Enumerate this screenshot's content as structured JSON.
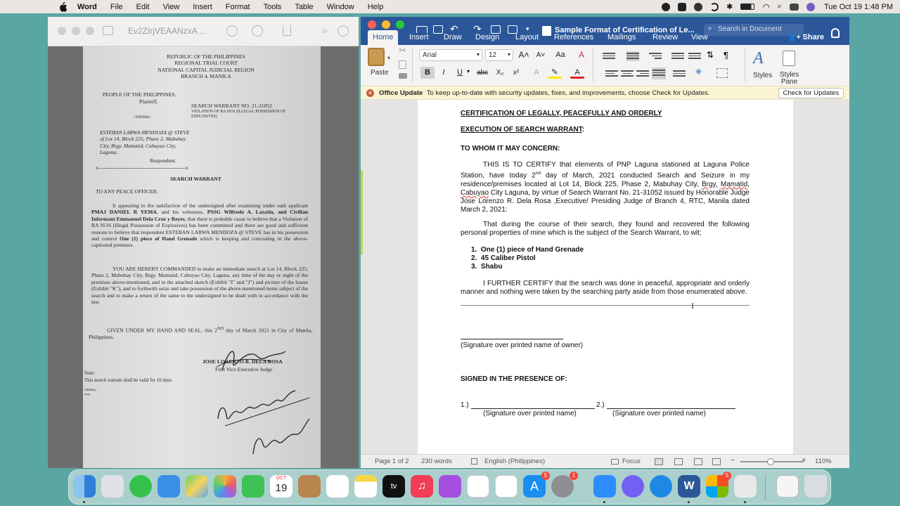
{
  "menubar": {
    "app": "Word",
    "items": [
      "File",
      "Edit",
      "View",
      "Insert",
      "Format",
      "Tools",
      "Table",
      "Window",
      "Help"
    ],
    "clock": "Tue Oct 19  1:48 PM"
  },
  "preview": {
    "title": "Ev2ZIrjVEAANzxA....",
    "doc": {
      "header": [
        "REPUBLIC OF THE PHILIPPINES",
        "REGIONAL TRIAL COURT",
        "NATIONAL CAPITAL JUDICIAL REGION",
        "BRANCH 4, MANILA"
      ],
      "plaintiff": "PEOPLE OF THE PHILIPPINES,",
      "plaintiff_role": "Plaintiff,",
      "warrant_no": "SEARCH WARRANT NO. 21-31052",
      "violation": "VIOLATION OF RA 9516 (ILLEGAL POSSESSION OF EXPLOSIVES)",
      "versus": "-versus-",
      "respondent_name": "ESTEBAN LARWA MENDOZA @ STEVE of Lot 14, Block 225, Phase 2, Mabuhay City, Brgy. Mamatid, Cabuyao City, Laguna,",
      "respondent_role": "Respondent.",
      "divider": "x-------------------------------------------------x",
      "heading": "SEARCH WARRANT",
      "salutation": "TO ANY PEACE OFFICER:",
      "p1_a": "It appearing to the satisfaction of the undersigned after examining under oath applicant ",
      "p1_b": "PMAJ DANIEL R YEMA",
      "p1_c": ", and his witnesses, ",
      "p1_d": "PSSG Wilfredo A. Lazatin, and Civilian Informant Emmanuel Dela Cruz y Reyes",
      "p1_e": ", that there is probable cause to believe that a Violation of RA 9516 (Illegal Possession of Explosives) has been committed and there are good and sufficient reasons to believe that respondent ESTEBAN LARWA MENDOZA @ STEVE has in his possession and control ",
      "p1_f": "One (1) piece of Hand Grenade",
      "p1_g": " which is keeping and concealing in the above-captioned premises.",
      "p2": "YOU ARE HEREBY COMMANDED to make an immediate search at Lot 14, Block 225, Phase 2, Mabuhay City, Brgy. Mamatid, Cabuyao City, Laguna, any time of the day or night of the premises above-mentioned, and in the attached sketch (Exhibit \"I\" and \"J\") and picture of the house (Exhibit \"K\"), and to forthwith seize and take possession of the above-mentioned items subject of the search and to make a return of the same to the undersigned to be dealt with in accordance with the law.",
      "p3_a": "GIVEN UNDER MY HAND AND SEAL, this 2",
      "p3_sup": "ND",
      "p3_b": " day of March 2021 in City of Manila, Philippines.",
      "judge": "JOSE LORENZO R. DELA ROSA",
      "judge_title": "First Vice Executive Judge",
      "note_label": "Note:",
      "note": "This search warrant shall be valid for 10 days.",
      "small": "LRDR/jo eusy"
    }
  },
  "word": {
    "doc_title": "Sample Format of Certification of Le...",
    "search_placeholder": "Search in Document",
    "tabs": [
      "Home",
      "Insert",
      "Draw",
      "Design",
      "Layout",
      "References",
      "Mailings",
      "Review",
      "View"
    ],
    "share": "Share",
    "ribbon": {
      "paste": "Paste",
      "font": "Arial",
      "size": "12",
      "styles": "Styles",
      "styles_pane_1": "Styles",
      "styles_pane_2": "Pane"
    },
    "update": {
      "title": "Office Update",
      "message": "To keep up-to-date with security updates, fixes, and improvements, choose Check for Updates.",
      "button": "Check for Updates"
    },
    "document": {
      "heading1": "CERTIFICATION OF LEGALLY, PEACEFULLY AND ORDERLY",
      "heading2": "EXECUTION OF SEARCH WARRANT",
      "heading2_colon": ":",
      "to_whom": "TO WHOM IT MAY CONCERN:",
      "p1_a": "THIS IS TO CERTIFY that elements of PNP Laguna stationed at Laguna Police Station, have today 2",
      "p1_sup": "nd",
      "p1_b": " day of March, 2021 conducted Search and Seizure in my residence/premises located at Lot 14, Block 225, Phase 2, Mabuhay City, ",
      "p1_brgy": "Brgy",
      "p1_c": ", ",
      "p1_mamatid": "Mamatid",
      "p1_d": ", ",
      "p1_cabuyao": "Cabuyao",
      "p1_e": " City Laguna, by virtue of Search Warrant No. 21-31052 issued by Honorable Judge Jose Lorenzo R. Dela Rosa ,Executive/ Presiding Judge of Branch 4, RTC, Manila dated March 2, 2021:",
      "p2": "That during the course of their search, they found and recovered the following personal properties of mine which is the subject of the Search Warrant, to wit;",
      "items": [
        "One (1) piece of Hand Grenade",
        "45 Caliber Pistol",
        "Shabu"
      ],
      "p3": "I FURTHER CERTIFY that the search was done in peaceful, appropriate and orderly manner and nothing were taken by the searching party aside from those enumerated  above.",
      "owner_sig": "(Signature over printed name of owner)",
      "signed": "SIGNED IN THE PRESENCE OF:",
      "w1_num": "1.)",
      "w2_num": "2.)",
      "w_label": "(Signature over printed name)"
    },
    "status": {
      "page": "Page 1 of 2",
      "words": "230 words",
      "language": "English (Philippines)",
      "focus": "Focus",
      "zoom": "110%"
    }
  },
  "dock": {
    "calendar_month": "OCT",
    "calendar_day": "19",
    "badges": {
      "appstore": "5",
      "settings": "1",
      "misc": "5"
    }
  },
  "colors": {
    "word_blue": "#2b579a",
    "desktop": "#5aa6a3",
    "update_bar": "#faf4d2"
  }
}
